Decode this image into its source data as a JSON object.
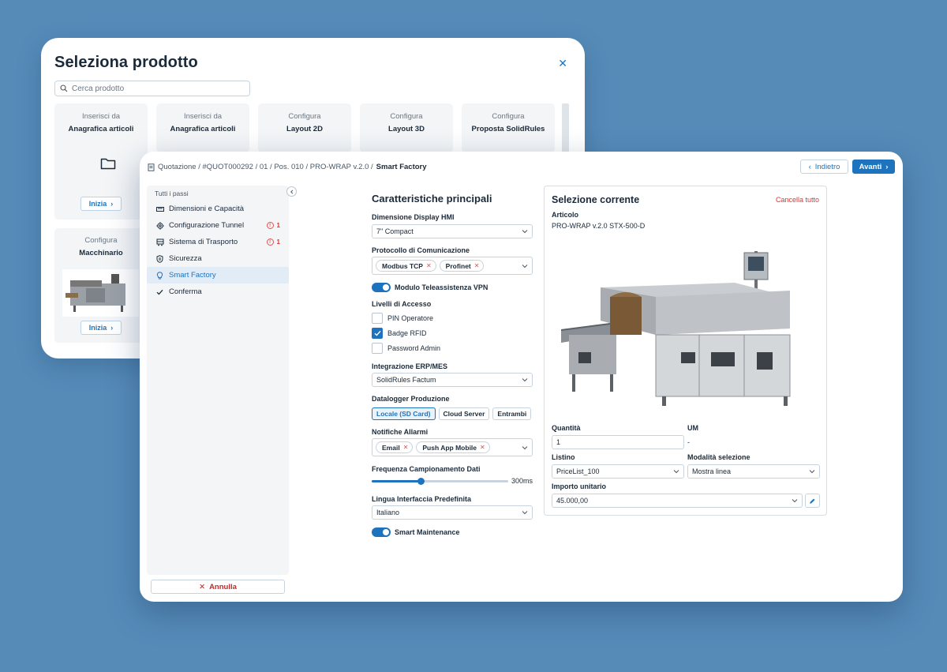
{
  "back_dialog": {
    "title": "Seleziona prodotto",
    "search_placeholder": "Cerca prodotto",
    "tiles": [
      {
        "line1": "Inserisci da",
        "line2": "Anagrafica articoli",
        "button": "Inizia"
      },
      {
        "line1": "Inserisci da",
        "line2": "Anagrafica articoli"
      },
      {
        "line1": "Configura",
        "line2": "Layout 2D"
      },
      {
        "line1": "Configura",
        "line2": "Layout 3D"
      },
      {
        "line1": "Configura",
        "line2": "Proposta SolidRules"
      },
      {
        "line1": "Configura",
        "line2": "Macchinario",
        "button": "Inizia"
      }
    ]
  },
  "breadcrumb": {
    "path": "Quotazione / #QUOT000292 / 01 / Pos. 010 / PRO-WRAP v.2.0 /",
    "current": "Smart Factory"
  },
  "nav": {
    "back_label": "Indietro",
    "next_label": "Avanti"
  },
  "sidebar": {
    "header": "Tutti i passi",
    "items": [
      {
        "label": "Dimensioni e Capacità",
        "icon": "ruler-icon"
      },
      {
        "label": "Configurazione Tunnel",
        "icon": "gear-icon",
        "badge": "1"
      },
      {
        "label": "Sistema di Trasporto",
        "icon": "conveyor-icon",
        "badge": "1"
      },
      {
        "label": "Sicurezza",
        "icon": "shield-icon"
      },
      {
        "label": "Smart Factory",
        "icon": "bulb-icon",
        "active": true
      },
      {
        "label": "Conferma",
        "icon": "check-icon"
      }
    ],
    "cancel_label": "Annulla"
  },
  "form": {
    "title": "Caratteristiche principali",
    "display_label": "Dimensione Display HMI",
    "display_value": "7\" Compact",
    "protocol_label": "Protocollo di Comunicazione",
    "protocol_chips": [
      "Modbus TCP",
      "Profinet"
    ],
    "vpn_label": "Modulo Teleassistenza VPN",
    "access_label": "Livelli di Accesso",
    "access_options": [
      {
        "label": "PIN Operatore",
        "checked": false
      },
      {
        "label": "Badge RFID",
        "checked": true
      },
      {
        "label": "Password Admin",
        "checked": false
      }
    ],
    "erp_label": "Integrazione ERP/MES",
    "erp_value": "SolidRules Factum",
    "datalogger_label": "Datalogger Produzione",
    "datalogger_options": [
      "Locale (SD Card)",
      "Cloud Server",
      "Entrambi"
    ],
    "datalogger_selected": 0,
    "alarms_label": "Notifiche Allarmi",
    "alarms_chips": [
      "Email",
      "Push App Mobile"
    ],
    "frequency_label": "Frequenza Campionamento Dati",
    "frequency_value": "300ms",
    "frequency_fraction": 0.36,
    "language_label": "Lingua Interfaccia Predefinita",
    "language_value": "Italiano",
    "maintenance_label": "Smart Maintenance"
  },
  "selection": {
    "title": "Selezione corrente",
    "clear_label": "Cancella tutto",
    "article_label": "Articolo",
    "article_value": "PRO-WRAP v.2.0 STX-500-D",
    "qty_label": "Quantità",
    "qty_value": "1",
    "um_label": "UM",
    "um_value": "-",
    "listino_label": "Listino",
    "listino_value": "PriceList_100",
    "mode_label": "Modalità selezione",
    "mode_value": "Mostra linea",
    "price_label": "Importo unitario",
    "price_value": "45.000,00"
  },
  "colors": {
    "accent": "#1e73be",
    "danger": "#d33333",
    "background": "#568bb8"
  }
}
